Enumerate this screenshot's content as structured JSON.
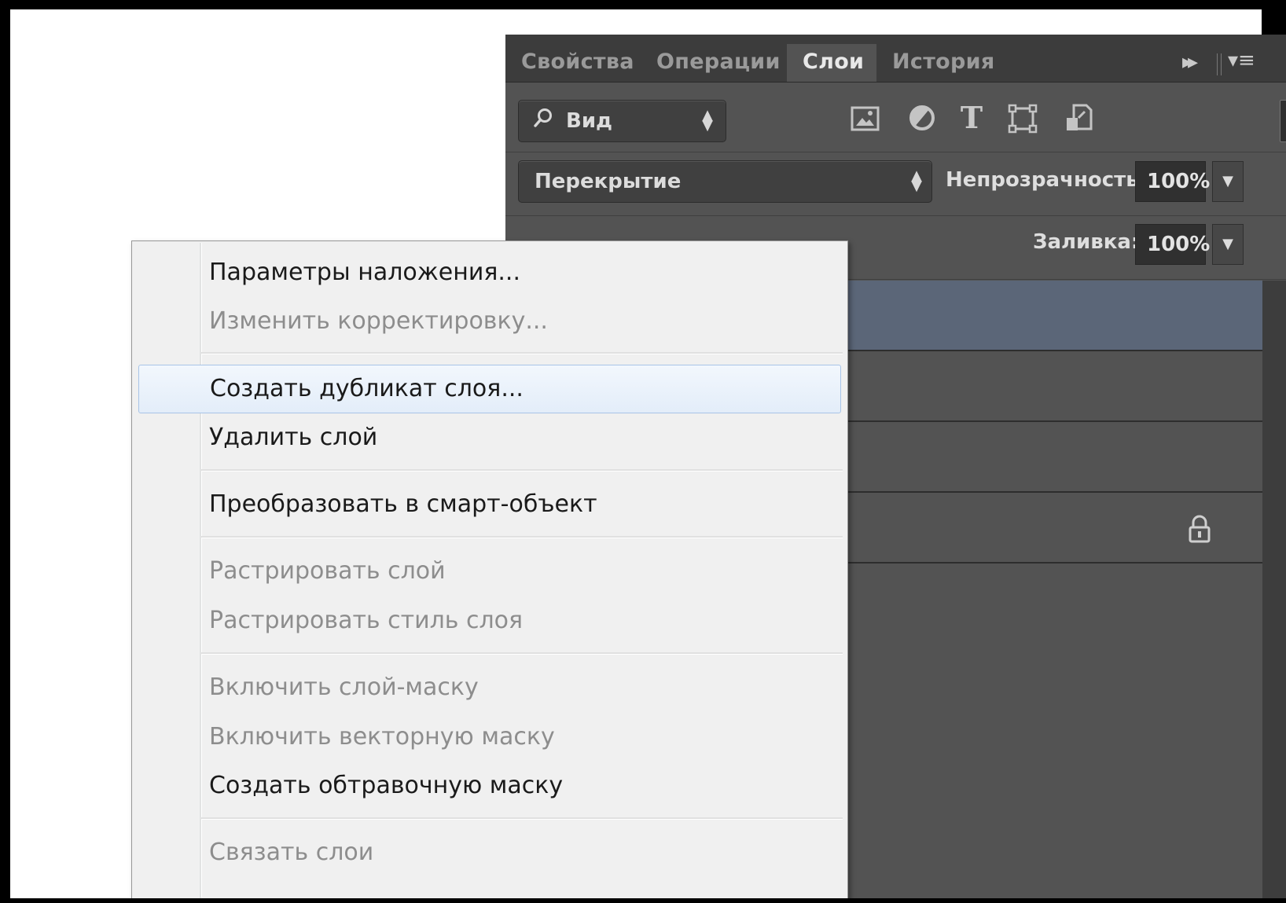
{
  "panel": {
    "tabs": [
      {
        "label": "Свойства",
        "active": false
      },
      {
        "label": "Операции",
        "active": false
      },
      {
        "label": "Слои",
        "active": true
      },
      {
        "label": "История",
        "active": false
      }
    ],
    "tab_overflow_glyph": "▸▸",
    "menu_glyph": "▾≡",
    "filter": {
      "kind_label": "Вид",
      "icons": [
        "image-filter-icon",
        "adjustment-filter-icon",
        "type-filter-icon",
        "shape-filter-icon",
        "smart-object-filter-icon"
      ],
      "type_glyph": "T"
    },
    "blend_mode": "Перекрытие",
    "opacity_label": "Непрозрачность:",
    "opacity_value": "100%",
    "fill_label": "Заливка:",
    "fill_value": "100%",
    "selected_layer_color": "#5b6678",
    "layers_count_visible": 4,
    "locked_layer_icon": "lock-icon"
  },
  "context_menu": {
    "hover_index": 2,
    "items": [
      {
        "label": "Параметры наложения...",
        "enabled": true
      },
      {
        "label": "Изменить корректировку...",
        "enabled": false
      },
      {
        "label": "Создать дубликат слоя...",
        "enabled": true
      },
      {
        "label": "Удалить слой",
        "enabled": true
      },
      {
        "label": "Преобразовать в смарт-объект",
        "enabled": true
      },
      {
        "label": "Растрировать слой",
        "enabled": false
      },
      {
        "label": "Растрировать стиль слоя",
        "enabled": false
      },
      {
        "label": "Включить слой-маску",
        "enabled": false
      },
      {
        "label": "Включить векторную маску",
        "enabled": false
      },
      {
        "label": "Создать обтравочную маску",
        "enabled": true
      },
      {
        "label": "Связать слои",
        "enabled": false
      }
    ]
  },
  "colors": {
    "panel_bg": "#535353",
    "tabbar_bg": "#3c3c3c",
    "menu_bg": "#f0f0f0",
    "menu_hover_border": "#a8c4e7",
    "disabled_text": "#8d8d8d"
  }
}
